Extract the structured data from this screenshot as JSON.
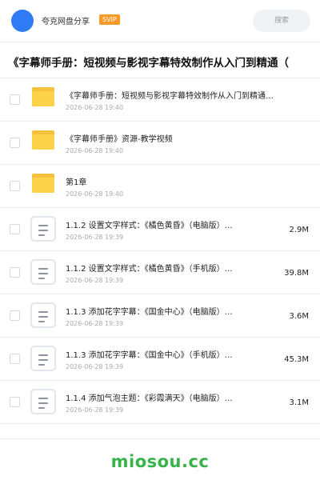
{
  "header": {
    "username": "夸克网盘分享",
    "badge": "SVIP",
    "search_placeholder": "搜索"
  },
  "share": {
    "title": "《字幕师手册：短视频与影视字幕特效制作从入门到精通（"
  },
  "files": [
    {
      "type": "folder",
      "name": "《字幕师手册：短视频与影视字幕特效制作从入门到精通…",
      "date": "2026-06-28 19:40",
      "size": ""
    },
    {
      "type": "folder",
      "name": "《字幕师手册》资源-教学视频",
      "date": "2026-06-28 19:40",
      "size": ""
    },
    {
      "type": "folder",
      "name": "第1章",
      "date": "2026-06-28 19:40",
      "size": ""
    },
    {
      "type": "file",
      "name": "1.1.2  设置文字样式：《橘色黄昏》（电脑版）…",
      "date": "2026-06-28 19:39",
      "size": "2.9M"
    },
    {
      "type": "file",
      "name": "1.1.2  设置文字样式：《橘色黄昏》（手机版）…",
      "date": "2026-06-28 19:39",
      "size": "39.8M"
    },
    {
      "type": "file",
      "name": "1.1.3  添加花字字幕：《国金中心》（电脑版）…",
      "date": "2026-06-28 19:39",
      "size": "3.6M"
    },
    {
      "type": "file",
      "name": "1.1.3  添加花字字幕：《国金中心》（手机版）…",
      "date": "2026-06-28 19:39",
      "size": "45.3M"
    },
    {
      "type": "file",
      "name": "1.1.4  添加气泡主题：《彩霞满天》（电脑版）…",
      "date": "2026-06-28 19:39",
      "size": "3.1M"
    }
  ],
  "footer": {
    "brand": "miosou.cc"
  },
  "colors": {
    "accent": "#2f7bf6",
    "badge": "#f79a2a",
    "folder": "#fcd24b",
    "brand": "#37b34a"
  }
}
